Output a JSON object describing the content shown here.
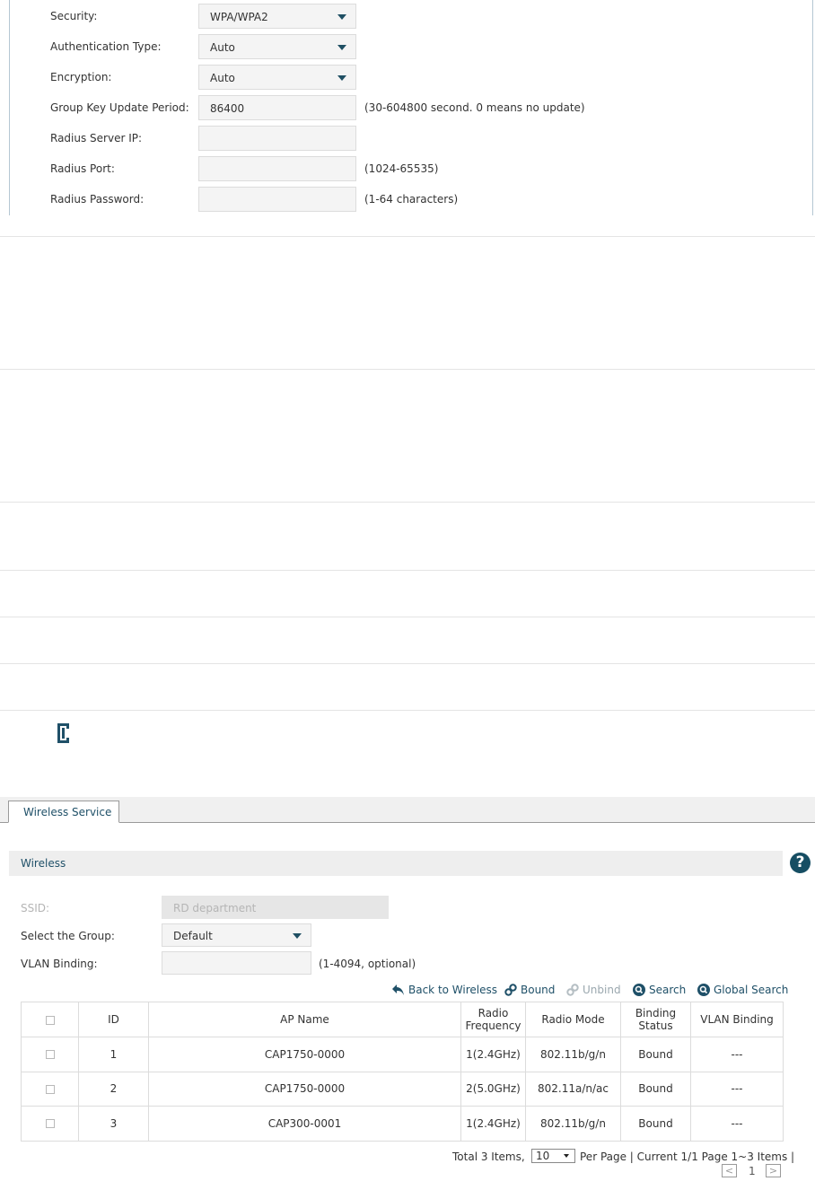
{
  "security_form": {
    "security_label": "Security:",
    "security_value": "WPA/WPA2",
    "auth_label": "Authentication Type:",
    "auth_value": "Auto",
    "encryption_label": "Encryption:",
    "encryption_value": "Auto",
    "gkup_label": "Group Key Update Period:",
    "gkup_value": "86400",
    "gkup_hint": "(30-604800 second. 0 means no update)",
    "radius_ip_label": "Radius Server IP:",
    "radius_ip_value": "",
    "radius_port_label": "Radius Port:",
    "radius_port_value": "",
    "radius_port_hint": "(1024-65535)",
    "radius_pw_label": "Radius Password:",
    "radius_pw_value": "",
    "radius_pw_hint": "(1-64  characters)"
  },
  "tabs": [
    {
      "label": "Wireless Service",
      "active": true
    }
  ],
  "section_title": "Wireless",
  "form": {
    "ssid_label": "SSID:",
    "ssid_value": "RD department",
    "group_label": "Select the Group:",
    "group_value": "Default",
    "vlan_label": "VLAN Binding:",
    "vlan_value": "",
    "vlan_hint": "(1-4094, optional)"
  },
  "toolbar": {
    "back": "Back to Wireless",
    "bound": "Bound",
    "unbind": "Unbind",
    "search": "Search",
    "global_search": "Global Search"
  },
  "table": {
    "headers": {
      "id": "ID",
      "ap_name": "AP Name",
      "radio_frequency_1": "Radio",
      "radio_frequency_2": "Frequency",
      "radio_mode": "Radio Mode",
      "binding_status_1": "Binding",
      "binding_status_2": "Status",
      "vlan_binding": "VLAN Binding"
    },
    "rows": [
      {
        "id": "1",
        "ap_name": "CAP1750-0000",
        "radio_frequency": "1(2.4GHz)",
        "radio_mode": "802.11b/g/n",
        "binding_status": "Bound",
        "vlan_binding": "---"
      },
      {
        "id": "2",
        "ap_name": "CAP1750-0000",
        "radio_frequency": "2(5.0GHz)",
        "radio_mode": "802.11a/n/ac",
        "binding_status": "Bound",
        "vlan_binding": "---"
      },
      {
        "id": "3",
        "ap_name": "CAP300-0001",
        "radio_frequency": "1(2.4GHz)",
        "radio_mode": "802.11b/g/n",
        "binding_status": "Bound",
        "vlan_binding": "---"
      }
    ]
  },
  "pagination": {
    "total": "Total 3 Items,",
    "per_page_value": "10",
    "per_page_label": "Per Page | Current 1/1 Page 1~3 Items |",
    "page_number": "1",
    "prev": "<",
    "next": ">"
  },
  "colors": {
    "accent": "#1f5068",
    "help_icon": "#164e63",
    "panel_border": "#b5c7d3"
  }
}
